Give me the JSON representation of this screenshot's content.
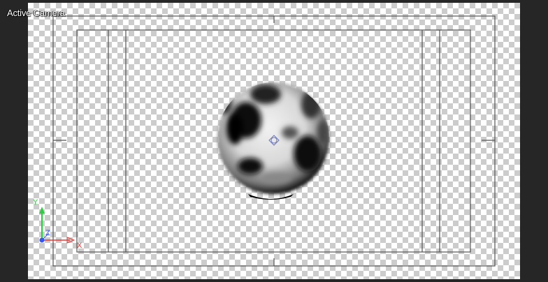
{
  "viewport": {
    "label": "Active Camera"
  },
  "gizmo": {
    "y_label": "Y",
    "z_label": "Z",
    "x_label": "X",
    "x_color": "#e53935",
    "y_color": "#2ecc40",
    "z_color": "#3355ff"
  },
  "colors": {
    "background": "#262626",
    "frame": "#555555"
  }
}
